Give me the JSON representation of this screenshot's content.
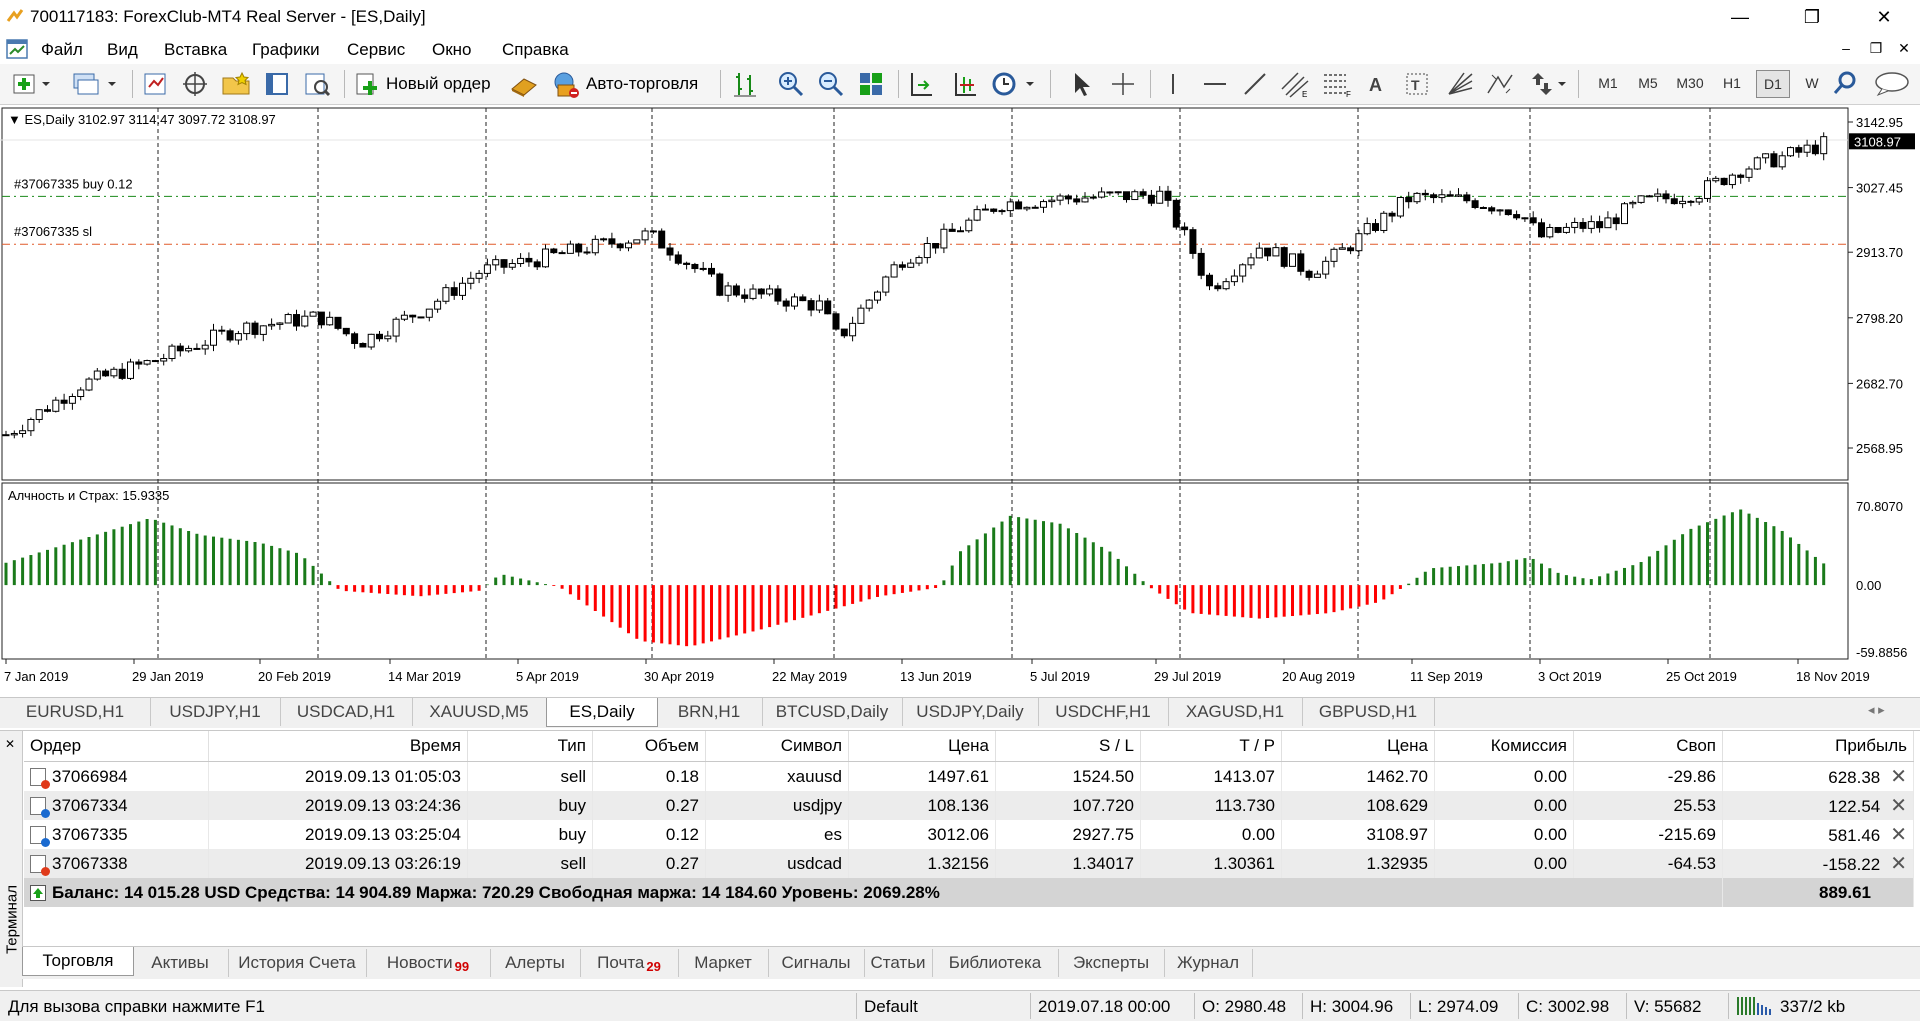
{
  "window": {
    "title": "700117183: ForexClub-MT4 Real Server - [ES,Daily]"
  },
  "menu": [
    "Файл",
    "Вид",
    "Вставка",
    "Графики",
    "Сервис",
    "Окно",
    "Справка"
  ],
  "toolbar": {
    "new_order": "Новый ордер",
    "autotrading": "Авто-торговля",
    "timeframes": [
      "M1",
      "M5",
      "M30",
      "H1",
      "D1",
      "W"
    ]
  },
  "chart": {
    "symbol_info": "ES,Daily  3102.97 3114.47 3097.72 3108.97",
    "price_scale": [
      "3142.95",
      "3027.45",
      "2913.70",
      "2798.20",
      "2682.70",
      "2568.95"
    ],
    "current_price": "3108.97",
    "order_lines": [
      {
        "label": "#37067335 buy 0.12",
        "color": "#1a8a1a",
        "price": 3012.06
      },
      {
        "label": "#37067335 sl",
        "color": "#e05a2a",
        "price": 2927.75
      }
    ],
    "indicator": {
      "label": "Алчность и Страх: 15.9335",
      "scale": [
        "70.8070",
        "0.00",
        "-59.8856"
      ],
      "up_color": "#1a7a1a",
      "down_color": "#ff0000"
    },
    "date_labels": [
      "7 Jan 2019",
      "29 Jan 2019",
      "20 Feb 2019",
      "14 Mar 2019",
      "5 Apr 2019",
      "30 Apr 2019",
      "22 May 2019",
      "13 Jun 2019",
      "5 Jul 2019",
      "29 Jul 2019",
      "20 Aug 2019",
      "11 Sep 2019",
      "3 Oct 2019",
      "25 Oct 2019",
      "18 Nov 2019"
    ]
  },
  "chart_tabs": [
    "EURUSD,H1",
    "USDJPY,H1",
    "USDCAD,H1",
    "XAUUSD,M5",
    "ES,Daily",
    "BRN,H1",
    "BTCUSD,Daily",
    "USDJPY,Daily",
    "USDCHF,H1",
    "XAGUSD,H1",
    "GBPUSD,H1"
  ],
  "chart_tabs_active": "ES,Daily",
  "terminal": {
    "side_label": "Терминал",
    "columns": [
      "Ордер",
      "Время",
      "Тип",
      "Объем",
      "Символ",
      "Цена",
      "S / L",
      "T / P",
      "Цена",
      "Комиссия",
      "Своп",
      "Прибыль"
    ],
    "rows": [
      {
        "order": "37066984",
        "time": "2019.09.13 01:05:03",
        "type": "sell",
        "volume": "0.18",
        "symbol": "xauusd",
        "price": "1497.61",
        "sl": "1524.50",
        "tp": "1413.07",
        "cur": "1462.70",
        "commission": "0.00",
        "swap": "-29.86",
        "profit": "628.38"
      },
      {
        "order": "37067334",
        "time": "2019.09.13 03:24:36",
        "type": "buy",
        "volume": "0.27",
        "symbol": "usdjpy",
        "price": "108.136",
        "sl": "107.720",
        "tp": "113.730",
        "cur": "108.629",
        "commission": "0.00",
        "swap": "25.53",
        "profit": "122.54"
      },
      {
        "order": "37067335",
        "time": "2019.09.13 03:25:04",
        "type": "buy",
        "volume": "0.12",
        "symbol": "es",
        "price": "3012.06",
        "sl": "2927.75",
        "tp": "0.00",
        "cur": "3108.97",
        "commission": "0.00",
        "swap": "-215.69",
        "profit": "581.46"
      },
      {
        "order": "37067338",
        "time": "2019.09.13 03:26:19",
        "type": "sell",
        "volume": "0.27",
        "symbol": "usdcad",
        "price": "1.32156",
        "sl": "1.34017",
        "tp": "1.30361",
        "cur": "1.32935",
        "commission": "0.00",
        "swap": "-64.53",
        "profit": "-158.22"
      }
    ],
    "balance_line": "Баланс: 14 015.28 USD  Средства: 14 904.89  Маржа: 720.29  Свободная маржа: 14 184.60  Уровень: 2069.28%",
    "total_profit": "889.61",
    "tabs": [
      {
        "label": "Торговля"
      },
      {
        "label": "Активы"
      },
      {
        "label": "История Счета"
      },
      {
        "label": "Новости",
        "badge": "99"
      },
      {
        "label": "Алерты"
      },
      {
        "label": "Почта",
        "badge": "29"
      },
      {
        "label": "Маркет"
      },
      {
        "label": "Сигналы"
      },
      {
        "label": "Статьи"
      },
      {
        "label": "Библиотека"
      },
      {
        "label": "Эксперты"
      },
      {
        "label": "Журнал"
      }
    ],
    "active_tab": "Торговля"
  },
  "status": {
    "help": "Для вызова справки нажмите F1",
    "profile": "Default",
    "datetime": "2019.07.18 00:00",
    "open": "O: 2980.48",
    "high": "H: 3004.96",
    "low": "L: 2974.09",
    "close": "C: 3002.98",
    "volume": "V: 55682",
    "traffic": "337/2 kb"
  }
}
